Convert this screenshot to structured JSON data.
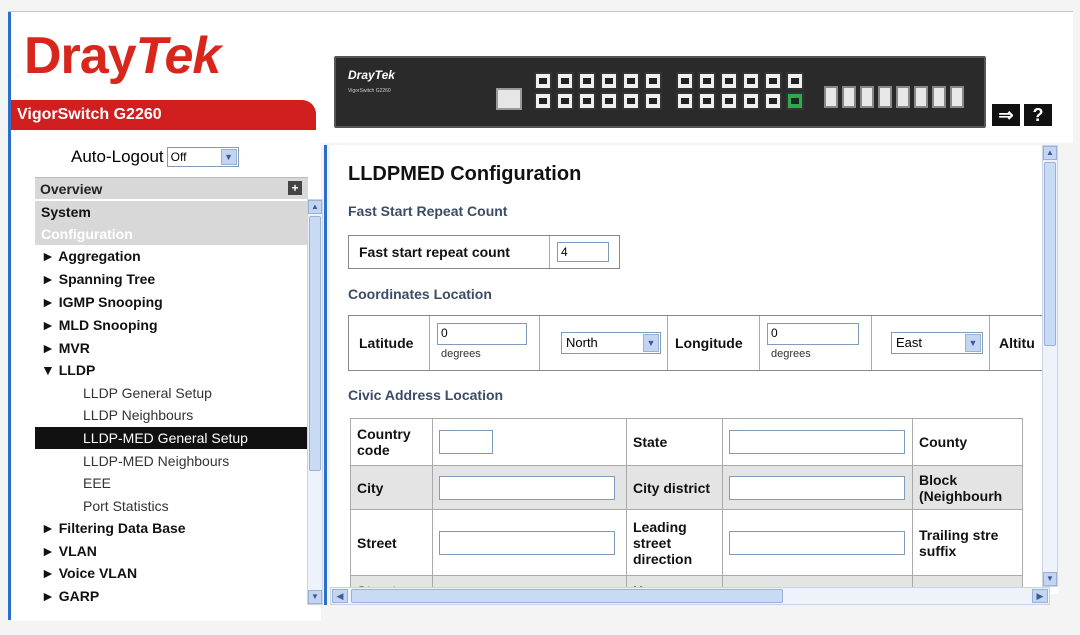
{
  "header": {
    "brand_left": "Dray",
    "brand_right": "Tek",
    "model": "VigorSwitch G2260",
    "switch_brand": "DrayTek",
    "switch_model": "VigorSwitch G2260",
    "logout_icon": "logout-arrow-icon",
    "help_label": "?"
  },
  "sidebar": {
    "autologout_label": "Auto-Logout",
    "autologout_value": "Off",
    "overview_label": "Overview",
    "system_label": "System",
    "configuration_label": "Configuration",
    "items": [
      {
        "label": "► Aggregation"
      },
      {
        "label": "► Spanning Tree"
      },
      {
        "label": "► IGMP Snooping"
      },
      {
        "label": "► MLD Snooping"
      },
      {
        "label": "► MVR"
      },
      {
        "label": "▼ LLDP"
      },
      {
        "label": "LLDP General Setup"
      },
      {
        "label": "LLDP Neighbours"
      },
      {
        "label": "LLDP-MED General Setup"
      },
      {
        "label": "LLDP-MED Neighbours"
      },
      {
        "label": "EEE"
      },
      {
        "label": "Port Statistics"
      },
      {
        "label": "► Filtering Data Base"
      },
      {
        "label": "► VLAN"
      },
      {
        "label": "► Voice VLAN"
      },
      {
        "label": "► GARP"
      }
    ]
  },
  "main": {
    "title": "LLDPMED Configuration",
    "fast_start": {
      "section_title": "Fast Start Repeat Count",
      "label": "Fast start repeat count",
      "value": "4"
    },
    "coordinates": {
      "section_title": "Coordinates Location",
      "latitude_label": "Latitude",
      "latitude_value": "0",
      "latitude_unit": "degrees",
      "latitude_dir": "North",
      "longitude_label": "Longitude",
      "longitude_value": "0",
      "longitude_unit": "degrees",
      "longitude_dir": "East",
      "altitude_label": "Altitu"
    },
    "civic": {
      "section_title": "Civic Address Location",
      "row1": {
        "c1": "Country code",
        "c2": "State",
        "c3": "County"
      },
      "row2": {
        "c1": "City",
        "c2": "City district",
        "c3": "Block (Neighbourh"
      },
      "row3": {
        "c1": "Street",
        "c2": "Leading street direction",
        "c3": "Trailing stre suffix"
      },
      "row4": {
        "c1": "Street",
        "c2": "House"
      }
    }
  }
}
